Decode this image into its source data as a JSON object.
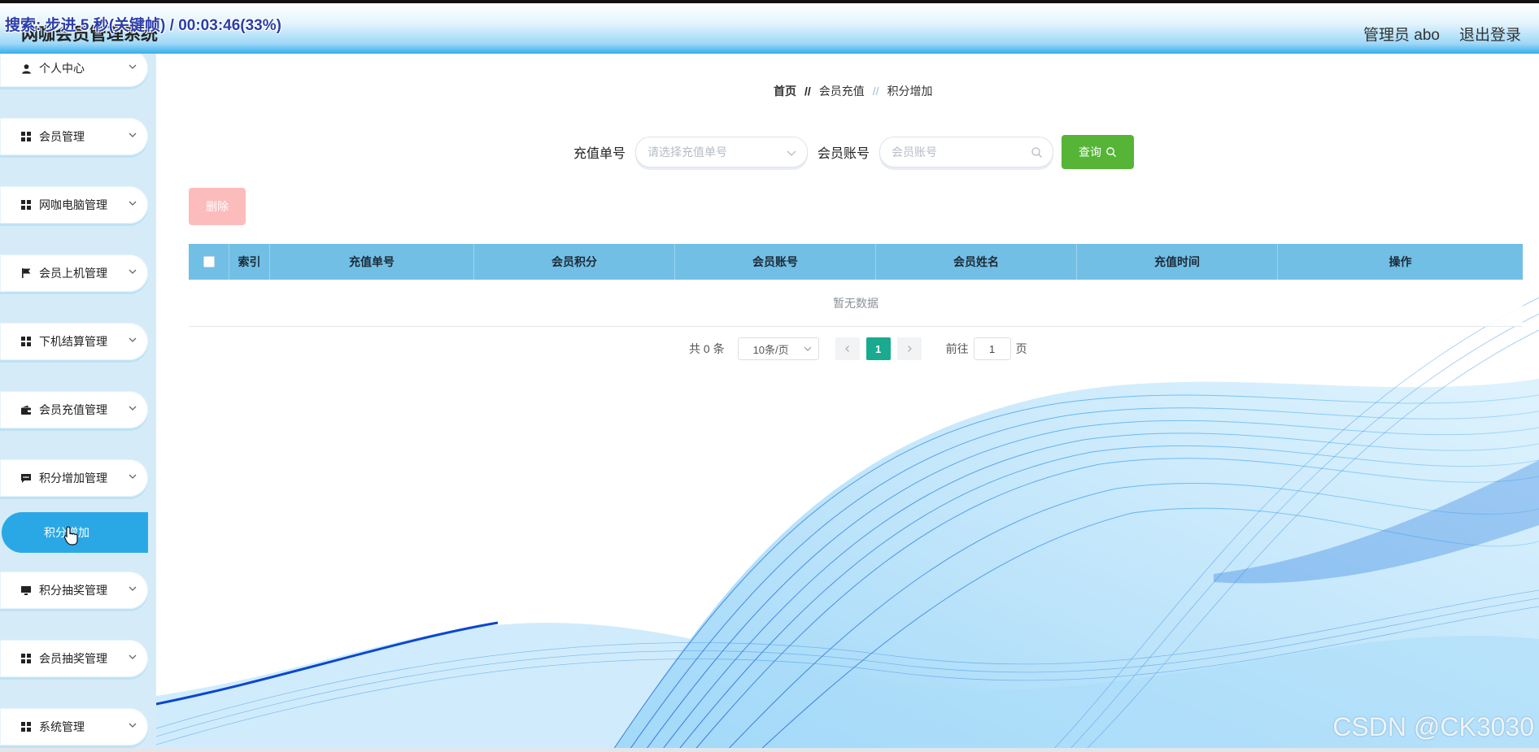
{
  "overlay": "搜索: 步进 5 秒(关键帧) / 00:03:46(33%)",
  "header": {
    "title": "网咖会员管理系统",
    "user": "管理员 abo",
    "logout": "退出登录"
  },
  "sidebar": {
    "items": [
      {
        "label": "个人中心",
        "icon": "user-icon"
      },
      {
        "label": "会员管理",
        "icon": "grid-icon"
      },
      {
        "label": "网咖电脑管理",
        "icon": "grid-icon"
      },
      {
        "label": "会员上机管理",
        "icon": "flag-icon"
      },
      {
        "label": "下机结算管理",
        "icon": "grid-icon"
      },
      {
        "label": "会员充值管理",
        "icon": "wallet-icon"
      },
      {
        "label": "积分增加管理",
        "icon": "chat-icon"
      },
      {
        "label": "积分抽奖管理",
        "icon": "monitor-icon"
      },
      {
        "label": "会员抽奖管理",
        "icon": "grid-icon"
      },
      {
        "label": "系统管理",
        "icon": "grid-icon"
      }
    ],
    "active_sub": "积分增加"
  },
  "breadcrumb": {
    "home": "首页",
    "sep1": "//",
    "level1": "会员充值",
    "sep2": "//",
    "level2": "积分增加"
  },
  "search": {
    "order_label": "充值单号",
    "order_placeholder": "请选择充值单号",
    "account_label": "会员账号",
    "account_placeholder": "会员账号",
    "query_label": "查询"
  },
  "actions": {
    "delete_label": "删除"
  },
  "table": {
    "columns": [
      "索引",
      "充值单号",
      "会员积分",
      "会员账号",
      "会员姓名",
      "充值时间",
      "操作"
    ],
    "empty_text": "暂无数据"
  },
  "pagination": {
    "total": "共 0 条",
    "page_size": "10条/页",
    "current_page": "1",
    "goto_label": "前往",
    "goto_value": "1",
    "page_suffix": "页"
  },
  "watermark": "CSDN @CK3030",
  "colors": {
    "header_blue": "#35aeea",
    "sidebar_bg": "#d5ecf8",
    "active_item": "#2aa8e6",
    "table_header": "#72bfe6",
    "query_green": "#56b437",
    "delete_pink": "#fdbcbc",
    "page_active": "#1aaa8f"
  }
}
